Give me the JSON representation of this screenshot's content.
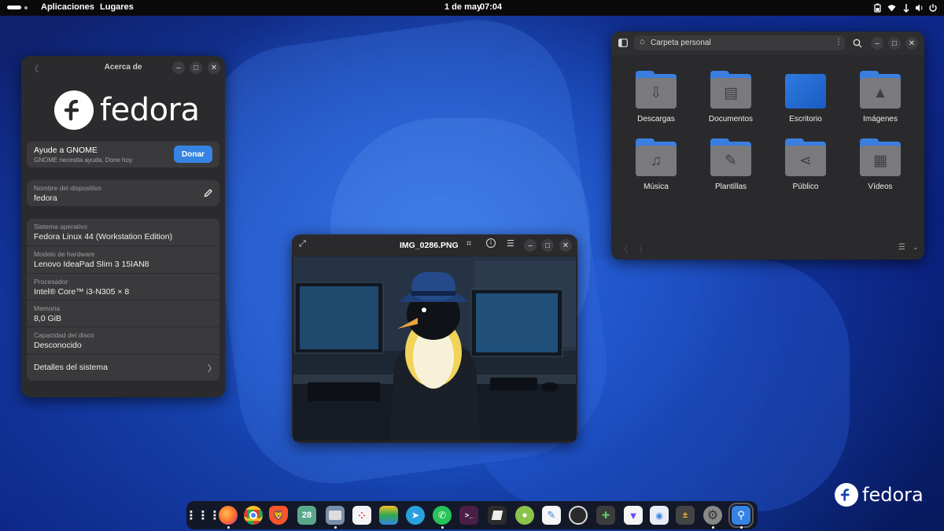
{
  "topbar": {
    "menu_apps": "Aplicaciones",
    "menu_places": "Lugares",
    "date": "1 de may",
    "time": "07:04"
  },
  "about": {
    "title": "Acerca de",
    "brand": "fedora",
    "gnome_title": "Ayude a GNOME",
    "gnome_sub": "GNOME necesita ayuda. Done hoy.",
    "donate": "Donar",
    "device_label": "Nombre del dispositivo",
    "device_value": "fedora",
    "rows": [
      {
        "label": "Sistema operativo",
        "value": "Fedora Linux 44 (Workstation Edition)"
      },
      {
        "label": "Modelo de hardware",
        "value": "Lenovo IdeaPad Slim 3 15IAN8"
      },
      {
        "label": "Procesador",
        "value": "Intel® Core™ i3-N305 × 8"
      },
      {
        "label": "Memoria",
        "value": "8,0 GiB"
      },
      {
        "label": "Capacidad del disco",
        "value": "Desconocido"
      }
    ],
    "details": "Detalles del sistema"
  },
  "files": {
    "location": "Carpeta personal",
    "folders": [
      "Descargas",
      "Documentos",
      "Escritorio",
      "Imágenes",
      "Música",
      "Plantillas",
      "Público",
      "Vídeos"
    ]
  },
  "viewer": {
    "title": "IMG_0286.PNG"
  },
  "desktop": {
    "brand": "fedora"
  },
  "dock": {
    "calendar_day": "28"
  },
  "colors": {
    "accent": "#3584e4",
    "folder": "#3a7ee0",
    "window_bg": "#2b2b2d",
    "card_bg": "#3a3a3c"
  }
}
